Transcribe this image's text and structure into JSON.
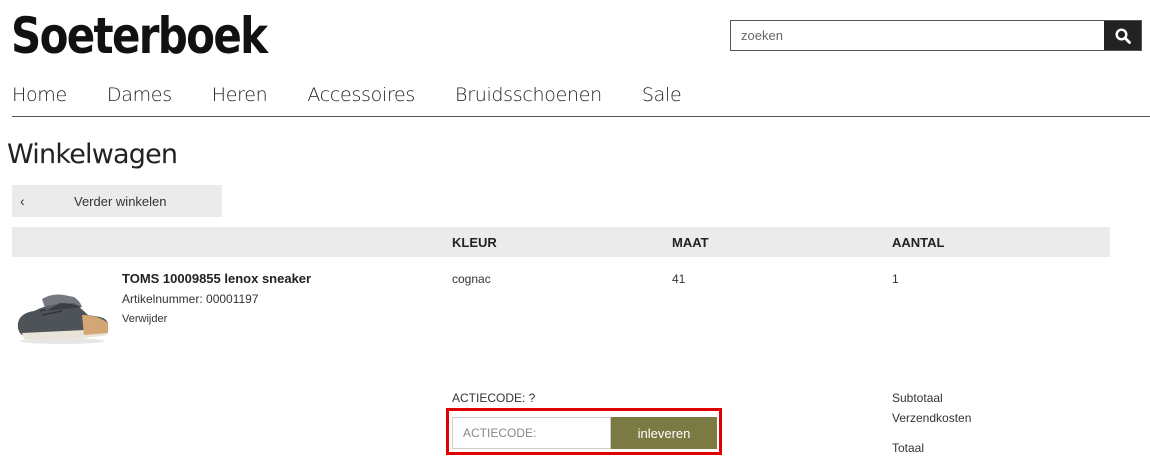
{
  "header": {
    "logo": "Soeterboek",
    "search_placeholder": "zoeken"
  },
  "nav": {
    "items": [
      "Home",
      "Dames",
      "Heren",
      "Accessoires",
      "Bruidsschoenen",
      "Sale"
    ]
  },
  "page": {
    "title": "Winkelwagen",
    "back_label": "Verder winkelen"
  },
  "table": {
    "headers": {
      "kleur": "KLEUR",
      "maat": "MAAT",
      "aantal": "AANTAL"
    },
    "rows": [
      {
        "name": "TOMS 10009855 lenox sneaker",
        "article": "Artikelnummer: 00001197",
        "remove": "Verwijder",
        "kleur": "cognac",
        "maat": "41",
        "aantal": "1"
      }
    ]
  },
  "promo": {
    "label": "ACTIECODE: ?",
    "placeholder": "ACTIECODE:",
    "button": "inleveren",
    "highlight_color": "#e00000",
    "button_color": "#7b7a43"
  },
  "summary": {
    "subtotal": "Subtotaal",
    "shipping": "Verzendkosten",
    "total": "Totaal"
  }
}
